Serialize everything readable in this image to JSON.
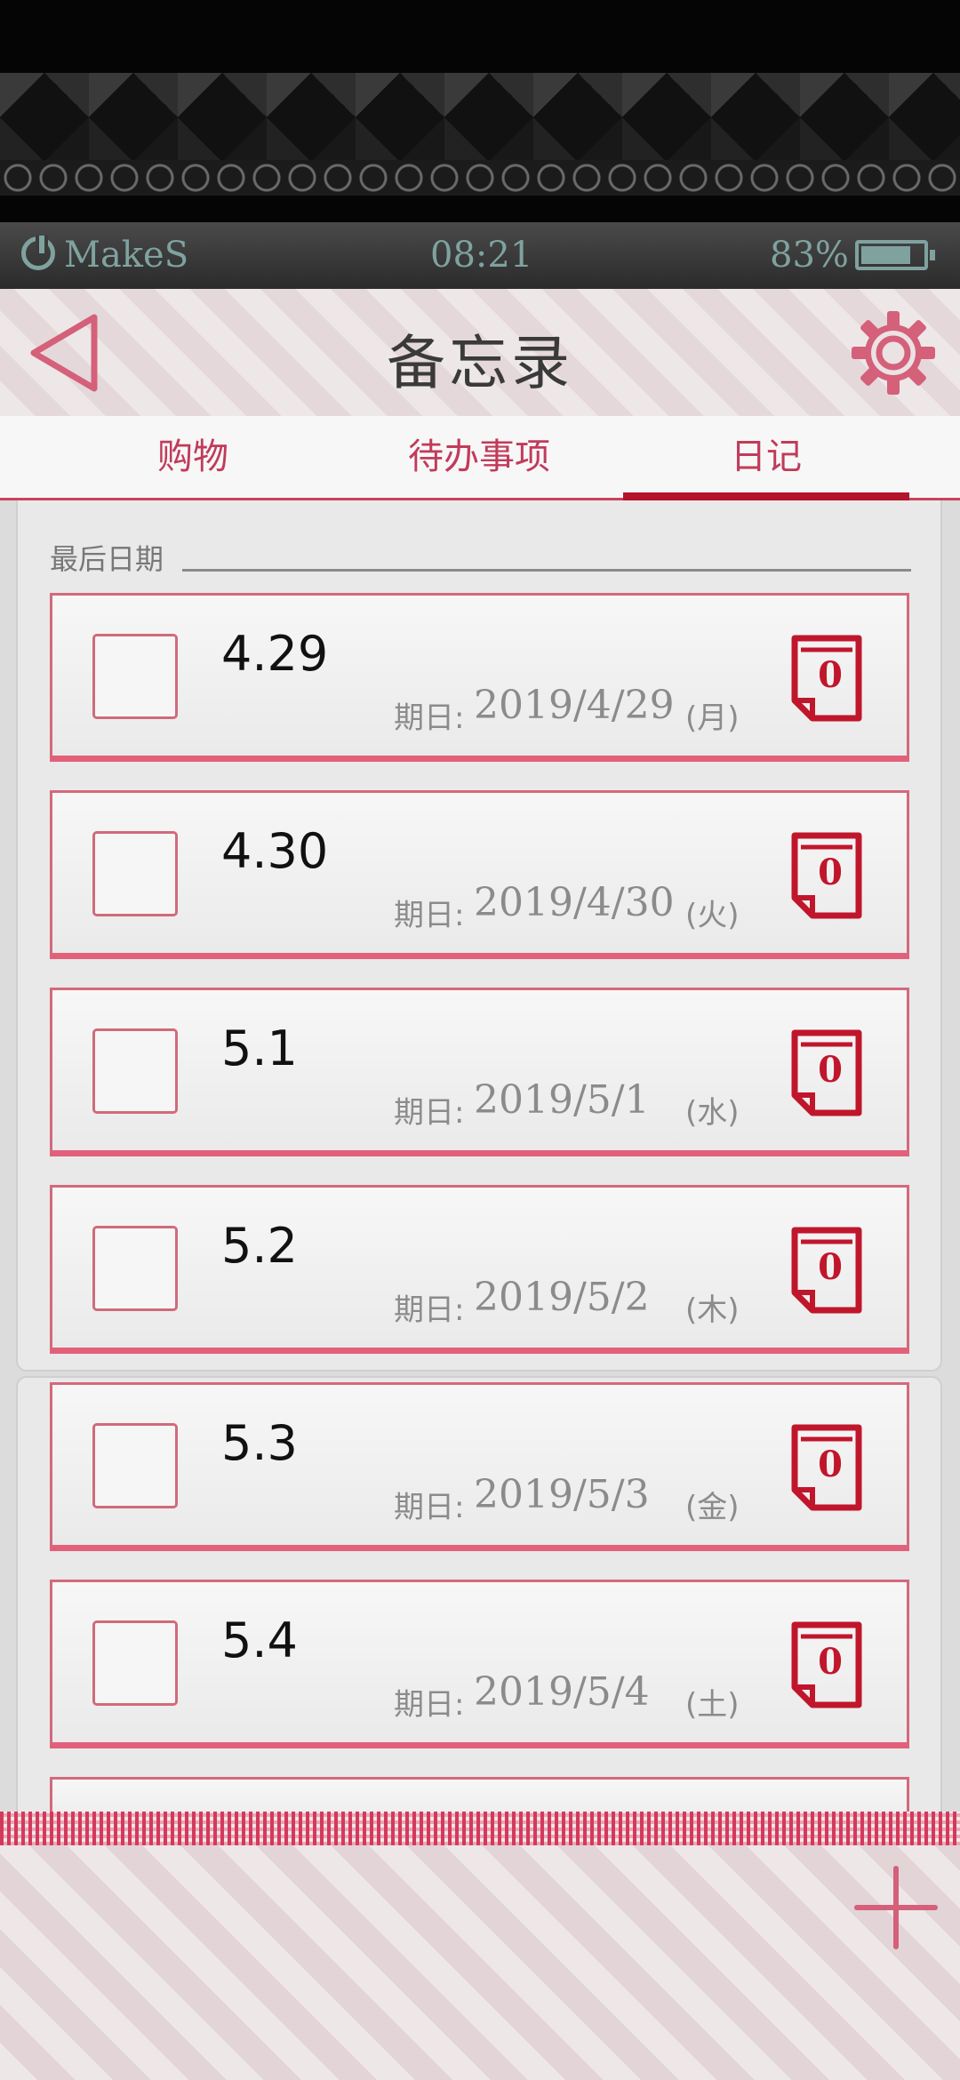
{
  "status_bar": {
    "carrier": "MakeS",
    "time": "08:21",
    "battery": "83%",
    "battery_level": 0.83
  },
  "header": {
    "title": "备忘录",
    "back_icon": "back-triangle-icon",
    "settings_icon": "gear-icon"
  },
  "tabs": [
    {
      "label": "购物",
      "active": false
    },
    {
      "label": "待办事项",
      "active": false
    },
    {
      "label": "日记",
      "active": true
    }
  ],
  "section": {
    "label": "最后日期"
  },
  "entries": [
    {
      "title": "4.29",
      "date_label": "期日:",
      "date": "2019/4/29",
      "weekday": "(月)",
      "count": "0",
      "checked": false
    },
    {
      "title": "4.30",
      "date_label": "期日:",
      "date": "2019/4/30",
      "weekday": "(火)",
      "count": "0",
      "checked": false
    },
    {
      "title": "5.1",
      "date_label": "期日:",
      "date": "2019/5/1",
      "weekday": "(水)",
      "count": "0",
      "checked": false
    },
    {
      "title": "5.2",
      "date_label": "期日:",
      "date": "2019/5/2",
      "weekday": "(木)",
      "count": "0",
      "checked": false
    },
    {
      "title": "5.3",
      "date_label": "期日:",
      "date": "2019/5/3",
      "weekday": "(金)",
      "count": "0",
      "checked": false
    },
    {
      "title": "5.4",
      "date_label": "期日:",
      "date": "2019/5/4",
      "weekday": "(土)",
      "count": "0",
      "checked": false
    }
  ],
  "colors": {
    "accent": "#c13b5a",
    "tab_underline": "#b3132b",
    "count_icon": "#c0162c",
    "status_text": "#7fa29f"
  },
  "add_icon": "plus-icon"
}
